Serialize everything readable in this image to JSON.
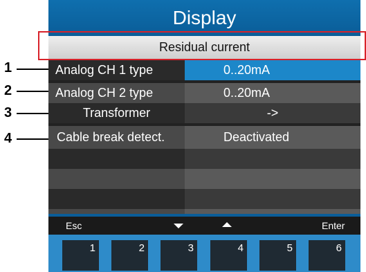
{
  "screen": {
    "title": "Display",
    "subheader": "Residual current"
  },
  "rows": [
    {
      "label": "Analog CH 1  type",
      "value": "0..20mA"
    },
    {
      "label": "Analog CH 2  type",
      "value": "0..20mA"
    },
    {
      "label": "Transformer",
      "value": "->"
    },
    {
      "label": "Cable break detect.",
      "value": "Deactivated"
    }
  ],
  "softkeys": {
    "esc": "Esc",
    "down_icon": "triangle-down-icon",
    "up_icon": "triangle-up-icon",
    "enter": "Enter"
  },
  "buttons": [
    "1",
    "2",
    "3",
    "4",
    "5",
    "6"
  ],
  "callouts": [
    "1",
    "2",
    "3",
    "4"
  ],
  "colors": {
    "title_blue": "#0f6fae",
    "selected_blue": "#1c87c9",
    "button_bar_blue": "#2e8bc9",
    "highlight_red": "#d8222a"
  }
}
